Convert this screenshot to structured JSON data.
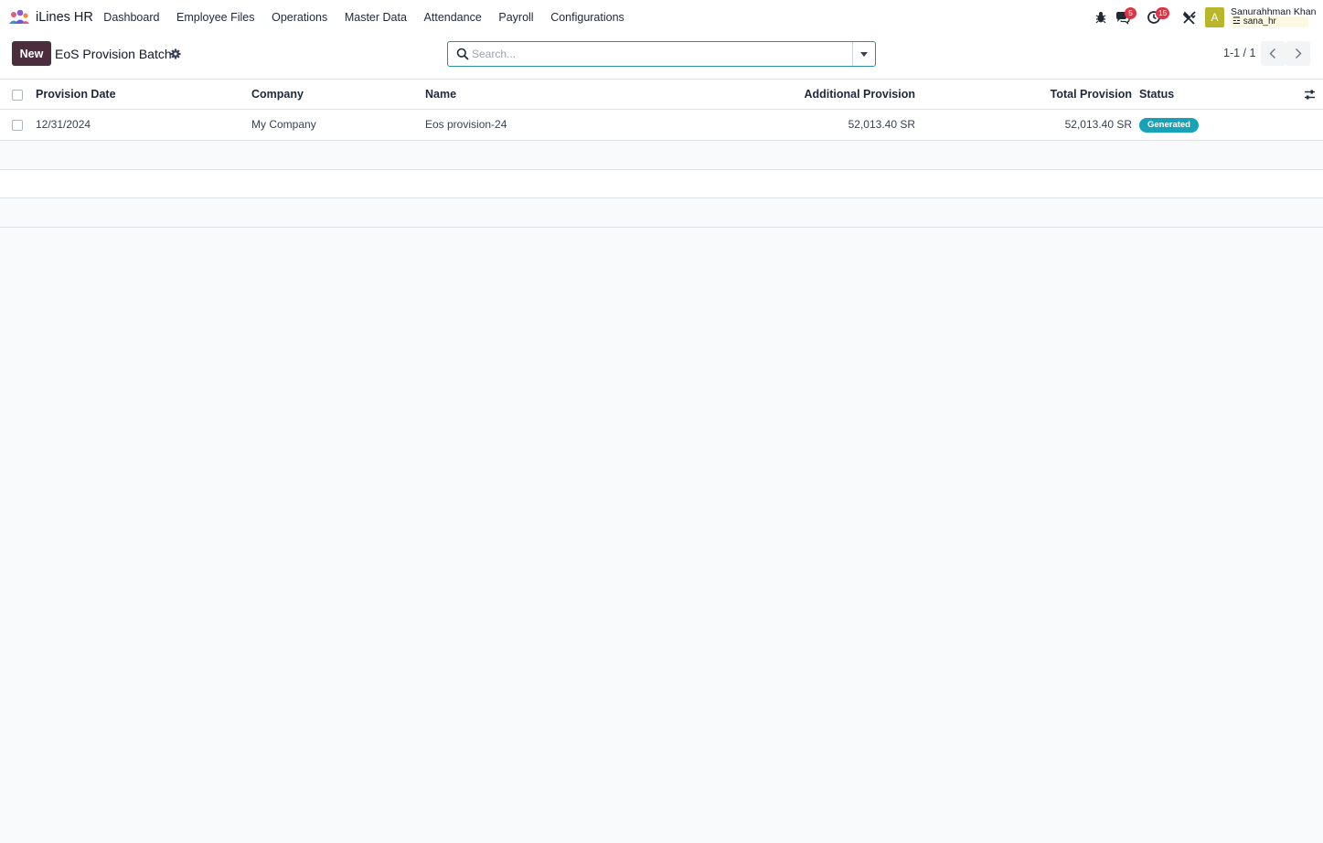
{
  "navbar": {
    "app_name": "iLines HR",
    "menu": [
      "Dashboard",
      "Employee Files",
      "Operations",
      "Master Data",
      "Attendance",
      "Payroll",
      "Configurations"
    ],
    "messages_count": "5",
    "activities_count": "15",
    "user": {
      "avatar_letter": "A",
      "name": "Sanurahhman Khan",
      "database": "sana_hr"
    }
  },
  "control_panel": {
    "new_label": "New",
    "title": "EoS Provision Batch",
    "search_placeholder": "Search...",
    "pager": "1-1 / 1"
  },
  "list": {
    "columns": [
      "Provision Date",
      "Company",
      "Name",
      "Additional Provision",
      "Total Provision",
      "Status"
    ],
    "rows": [
      {
        "provision_date": "12/31/2024",
        "company": "My Company",
        "name": "Eos provision-24",
        "additional_provision": "52,013.40 SR",
        "total_provision": "52,013.40 SR",
        "status": "Generated"
      }
    ]
  },
  "colors": {
    "primary": "#4c2d3e",
    "status_generated": "#17a2b8",
    "badge": "#dc3545",
    "search_border": "#2a8fa0"
  }
}
